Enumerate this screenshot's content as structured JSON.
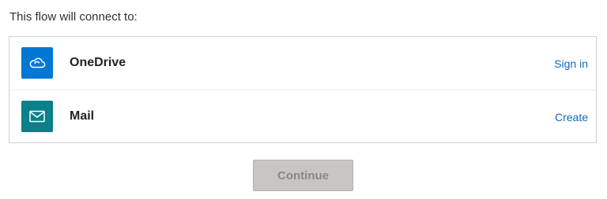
{
  "header": {
    "text": "This flow will connect to:"
  },
  "connections": [
    {
      "name": "OneDrive",
      "icon": "onedrive-cloud-icon",
      "icon_bg": "#0078d4",
      "action_label": "Sign in"
    },
    {
      "name": "Mail",
      "icon": "mail-envelope-icon",
      "icon_bg": "#0b7f8a",
      "action_label": "Create"
    }
  ],
  "footer": {
    "continue_label": "Continue",
    "continue_state": "disabled"
  },
  "colors": {
    "link": "#0f6cbd",
    "border": "#d2d0ce",
    "button_disabled_bg": "#c8c6c4",
    "button_disabled_text": "#8a8886"
  }
}
